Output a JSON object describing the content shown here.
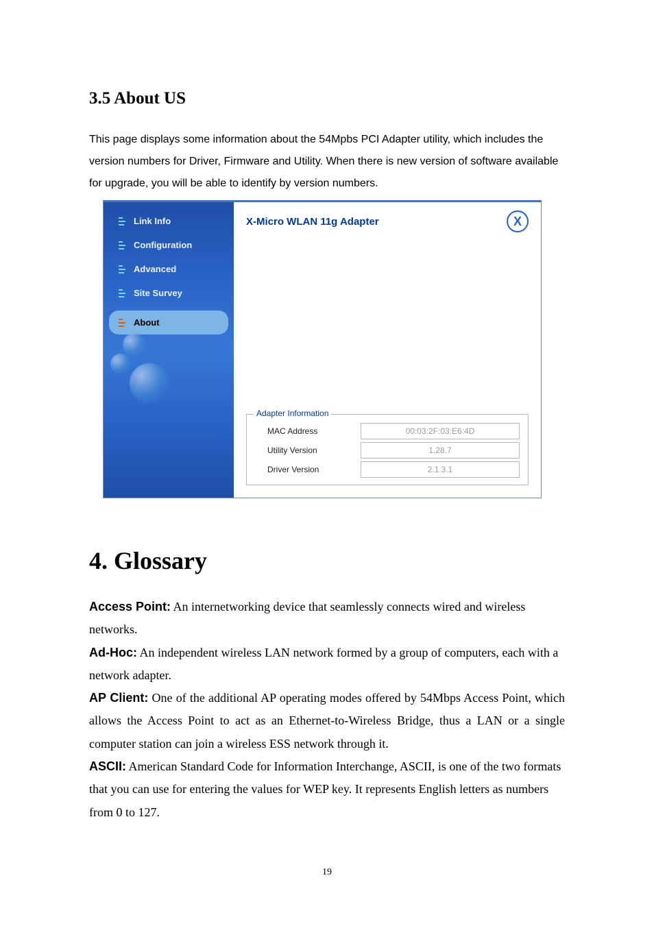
{
  "doc": {
    "section_heading": "3.5 About US",
    "intro": "This page displays some information about the 54Mpbs PCI Adapter utility, which includes the version numbers for Driver, Firmware and Utility.   When there is new version of software available for upgrade, you will be able to identify by version numbers.",
    "glossary_heading": "4. Glossary",
    "page_number": "19",
    "glossary": [
      {
        "term": "Access Point:",
        "def": " An internetworking device that seamlessly connects wired and wireless networks.",
        "justify": false
      },
      {
        "term": "Ad-Hoc:",
        "def": " An independent wireless LAN network formed by a group of computers, each with a network adapter.",
        "justify": false
      },
      {
        "term": "AP Client:",
        "def": " One of the additional AP operating modes offered by 54Mbps Access Point, which allows the Access Point to act as an Ethernet-to-Wireless Bridge, thus a LAN or a single computer station can join a wireless ESS network through it.",
        "justify": true
      },
      {
        "term": "ASCII:",
        "def": " American Standard Code for Information Interchange, ASCII, is one of the two formats that you can use for entering the values for WEP key. It represents English letters as numbers from 0 to 127.",
        "justify": false
      }
    ]
  },
  "app": {
    "title": "X-Micro WLAN 11g Adapter",
    "close_label": "X",
    "sidebar": {
      "items": [
        {
          "label": "Link Info",
          "active": false
        },
        {
          "label": "Configuration",
          "active": false
        },
        {
          "label": "Advanced",
          "active": false
        },
        {
          "label": "Site Survey",
          "active": false
        },
        {
          "label": "About",
          "active": true
        }
      ]
    },
    "fieldset_legend": "Adapter Information",
    "info": {
      "mac_label": "MAC Address",
      "mac_value": "00:03:2F:03:E6:4D",
      "util_label": "Utility Version",
      "util_value": "1.28.7",
      "drv_label": "Driver Version",
      "drv_value": "2.1.3.1"
    }
  }
}
